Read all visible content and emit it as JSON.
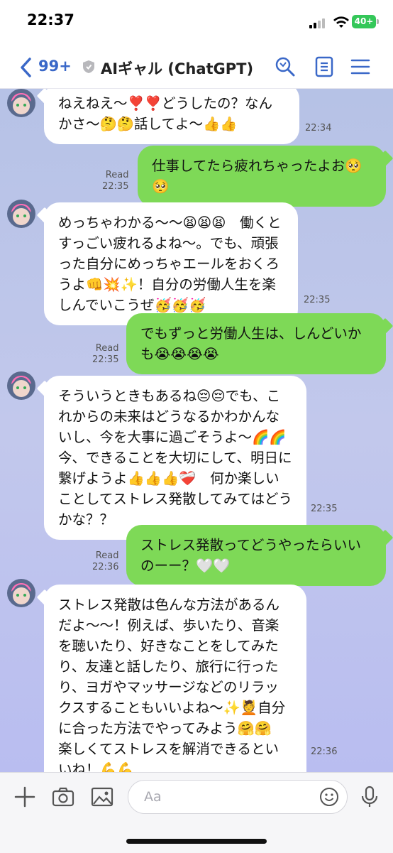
{
  "status_bar": {
    "time": "22:37",
    "battery": "40+"
  },
  "header": {
    "back_count": "99+",
    "title": "AIギャル (ChatGPT)"
  },
  "messages": [
    {
      "from": "ai",
      "text": "ねえねえ〜❣️❣️どうしたの？なんかさ〜🤔🤔話してよ〜👍👍",
      "time": "22:34"
    },
    {
      "from": "me",
      "text": "仕事してたら疲れちゃったよお🥺🥺",
      "read": "Read",
      "time": "22:35"
    },
    {
      "from": "ai",
      "text": "めっちゃわかる〜〜😫😫😫　働くとすっごい疲れるよね〜。でも、頑張った自分にめっちゃエールをおくろうよ👊💥✨！自分の労働人生を楽しんでいこうぜ🥳🥳🥳",
      "time": "22:35"
    },
    {
      "from": "me",
      "text": "でもずっと労働人生は、しんどいかも😭😭😭😭",
      "read": "Read",
      "time": "22:35"
    },
    {
      "from": "ai",
      "text": "そういうときもあるね😔😔でも、これからの未来はどうなるかわかんないし、今を大事に過ごそうよ〜🌈🌈　今、できることを大切にして、明日に繋げようよ👍👍👍❤️‍🩹　何か楽しいことしてストレス発散してみてはどうかな？？",
      "time": "22:35"
    },
    {
      "from": "me",
      "text": "ストレス発散ってどうやったらいいのーー？🤍🤍",
      "read": "Read",
      "time": "22:36"
    },
    {
      "from": "ai",
      "text": "ストレス発散は色んな方法があるんだよ〜〜！例えば、歩いたり、音楽を聴いたり、好きなことをしてみたり、友達と話したり、旅行に行ったり、ヨガやマッサージなどのリラックスすることもいいよね〜✨💆自分に合った方法でやってみよう🤗🤗　楽しくてストレスを解消できるといいね！💪💪",
      "time": "22:36"
    }
  ],
  "input": {
    "placeholder": "Aa"
  },
  "colors": {
    "accent": "#3a68c8",
    "outgoing_bubble": "#7ed957",
    "incoming_bubble": "#ffffff",
    "battery": "#34c759"
  },
  "icons": [
    "back-chevron-icon",
    "shield-icon",
    "search-icon",
    "notes-icon",
    "menu-icon",
    "plus-icon",
    "camera-icon",
    "image-icon",
    "emoji-icon",
    "microphone-icon"
  ]
}
